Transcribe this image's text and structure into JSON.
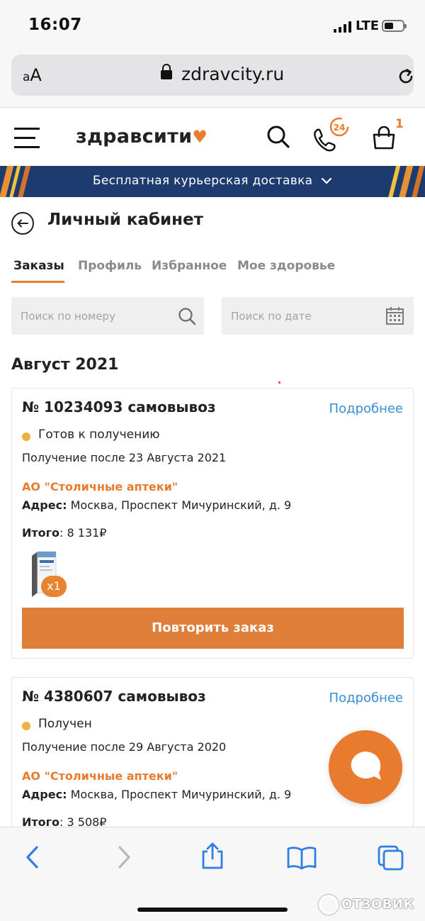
{
  "status_bar": {
    "time": "16:07",
    "network": "LTE"
  },
  "browser": {
    "text_size_label": "aA",
    "url": "zdravcity.ru"
  },
  "header": {
    "logo_text": "здравсити",
    "support_badge": "24",
    "cart_count": "1"
  },
  "banner": {
    "text": "Бесплатная курьерская доставка"
  },
  "page": {
    "title": "Личный кабинет"
  },
  "tabs": [
    {
      "label": "Заказы",
      "active": true
    },
    {
      "label": "Профиль",
      "active": false
    },
    {
      "label": "Избранное",
      "active": false
    },
    {
      "label": "Мое здоровье",
      "active": false
    }
  ],
  "search": {
    "number_placeholder": "Поиск по номеру",
    "date_placeholder": "Поиск по дате"
  },
  "orders_section": {
    "month": "Август 2021"
  },
  "orders": [
    {
      "title": "№ 10234093 самовывоз",
      "details_link": "Подробнее",
      "status": "Готов к получению",
      "receive_text": "Получение после 23 Августа 2021",
      "pharmacy": "АО \"Столичные аптеки\"",
      "address_label": "Адрес:",
      "address": "Москва, Проспект Мичуринский, д. 9",
      "total_label": "Итого",
      "total": ": 8 131₽",
      "product_qty": "x1",
      "repeat_button": "Повторить заказ"
    },
    {
      "title": "№ 4380607 самовывоз",
      "details_link": "Подробнее",
      "status": "Получен",
      "receive_text": "Получение после 29 Августа 2020",
      "pharmacy": "АО \"Столичные аптеки\"",
      "address_label": "Адрес:",
      "address": "Москва, Проспект Мичуринский, д. 9",
      "total_label": "Итого",
      "total": ": 3 508₽"
    }
  ],
  "watermark": "ОТЗОВИК",
  "colors": {
    "accent": "#e97b2e",
    "link": "#3a8dd6",
    "banner": "#1d3b6e",
    "status_dot": "#eeb13c"
  },
  "icons": [
    "search-icon",
    "phone-24-icon",
    "cart-icon",
    "calendar-icon",
    "back-arrow-icon",
    "chat-icon",
    "reload-icon",
    "lock-icon"
  ]
}
